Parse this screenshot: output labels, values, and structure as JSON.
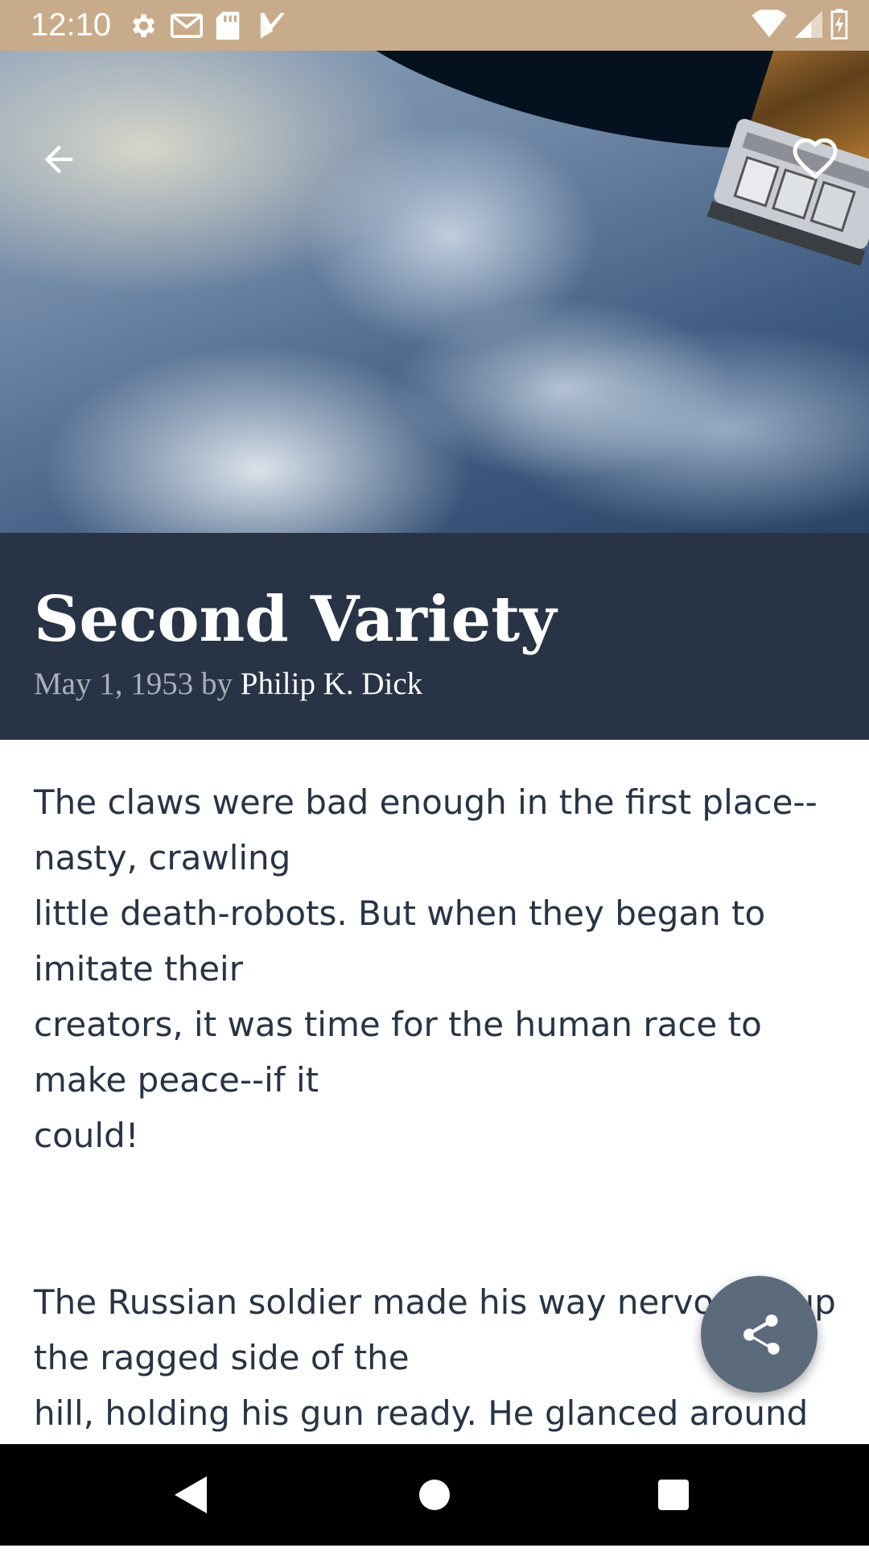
{
  "status_bar": {
    "time": "12:10",
    "left_icons": [
      "settings-icon",
      "gmail-icon",
      "sd-card-icon",
      "tasks-icon"
    ],
    "right_icons": [
      "wifi-icon",
      "signal-icon",
      "battery-icon"
    ]
  },
  "header": {
    "back_icon": "arrow-back-icon",
    "favorite_icon": "heart-outline-icon"
  },
  "story": {
    "title": "Second Variety",
    "date": "May 1, 1953",
    "by": "by",
    "author": "Philip K. Dick",
    "paragraphs": [
      "The claws were bad enough in the first place--nasty, crawling\nlittle death-robots. But when they began to imitate their\ncreators, it was time for the human race to make peace--if it\ncould!",
      "The Russian soldier made his way nervously up the ragged side of the\nhill, holding his gun ready. He glanced around"
    ]
  },
  "fab": {
    "icon": "share-icon"
  },
  "nav_bar": {
    "icons": [
      "nav-back-icon",
      "nav-home-icon",
      "nav-recents-icon"
    ]
  },
  "colors": {
    "status_bar": "#c8ab8a",
    "title_band": "#283445",
    "body_text": "#283445",
    "fab": "#5b6b7c"
  }
}
